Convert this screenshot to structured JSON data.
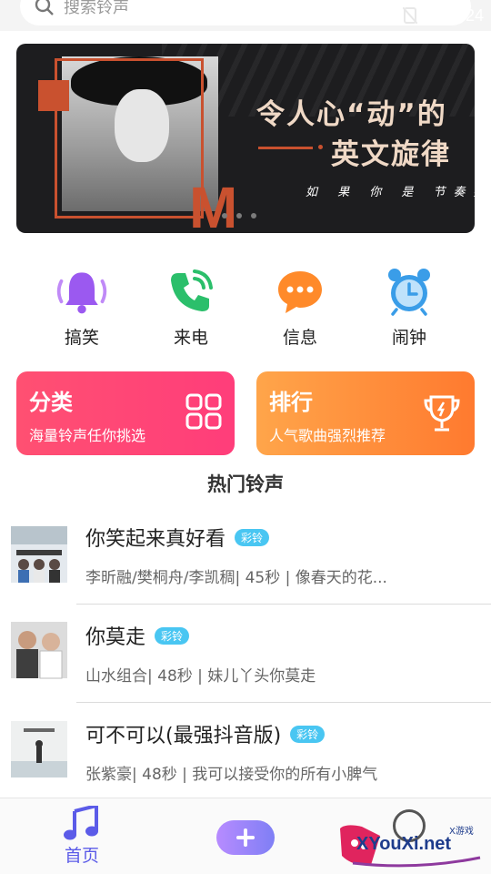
{
  "status_bar": {
    "time": "5:24"
  },
  "search": {
    "placeholder": "搜索铃声"
  },
  "banner": {
    "title": "令人心“动”的",
    "subtitle": "英文旋律",
    "tagline": "如 果 你 是 节奏控",
    "letter": "M"
  },
  "categories": [
    {
      "label": "搞笑",
      "icon": "bell-icon",
      "color": "#9b59f0"
    },
    {
      "label": "来电",
      "icon": "phone-icon",
      "color": "#2bbf6b"
    },
    {
      "label": "信息",
      "icon": "message-icon",
      "color": "#ff8a2a"
    },
    {
      "label": "闹钟",
      "icon": "alarm-clock-icon",
      "color": "#3a9de8"
    }
  ],
  "cards": [
    {
      "title": "分类",
      "subtitle": "海量铃声任你挑选",
      "icon": "grid-icon"
    },
    {
      "title": "排行",
      "subtitle": "人气歌曲强烈推荐",
      "icon": "trophy-icon"
    }
  ],
  "section_title": "热门铃声",
  "songs": [
    {
      "title": "你笑起来真好看",
      "badge": "彩铃",
      "meta": "李昕融/樊桐舟/李凯稠| 45秒 |  像春天的花..."
    },
    {
      "title": "你莫走",
      "badge": "彩铃",
      "meta": "山水组合| 48秒 |  妹儿丫头你莫走"
    },
    {
      "title": "可不可以(最强抖音版)",
      "badge": "彩铃",
      "meta": "张紫豪| 48秒 |  我可以接受你的所有小脾气"
    }
  ],
  "bottom_nav": {
    "home_label": "首页"
  },
  "watermark": {
    "brand": "XYouXi.net",
    "small": "X游戏"
  }
}
